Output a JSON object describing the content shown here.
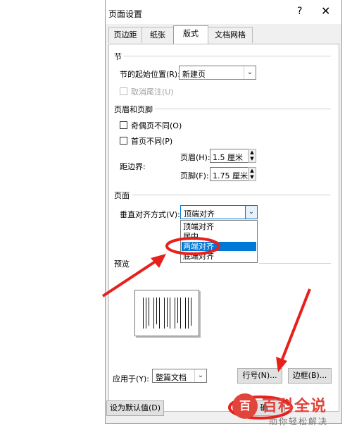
{
  "window": {
    "title": "页面设置",
    "help_glyph": "?",
    "close_glyph": "✕"
  },
  "tabs": [
    {
      "label": "页边距"
    },
    {
      "label": "纸张"
    },
    {
      "label": "版式",
      "active": true
    },
    {
      "label": "文档网格"
    }
  ],
  "section_start": {
    "heading": "节",
    "start_label": "节的起始位置(R):",
    "start_value": "新建页",
    "endnote_label": "取消尾注(U)"
  },
  "section_header_footer": {
    "heading": "页眉和页脚",
    "odd_even_label": "奇偶页不同(O)",
    "first_page_label": "首页不同(P)",
    "edge_label": "距边界:",
    "header_label": "页眉(H):",
    "header_value": "1.5 厘米",
    "footer_label": "页脚(F):",
    "footer_value": "1.75 厘米"
  },
  "section_page": {
    "heading": "页面",
    "valign_label": "垂直对齐方式(V):",
    "valign_value": "顶端对齐",
    "options": [
      "顶端对齐",
      "居中",
      "两端对齐",
      "底端对齐"
    ],
    "highlighted_option": "两端对齐"
  },
  "preview": {
    "heading": "预览"
  },
  "footer": {
    "apply_label": "应用于(Y):",
    "apply_value": "整篇文档",
    "line_numbers_button": "行号(N)...",
    "borders_button": "边框(B)...",
    "default_button": "设为默认值(D)",
    "ok_button": "确"
  },
  "watermark": {
    "title": "百科全说",
    "subtitle": "助你轻松解决",
    "logo_text": "百"
  },
  "annotation_color": "#e8201c",
  "accent": "#0078d7"
}
